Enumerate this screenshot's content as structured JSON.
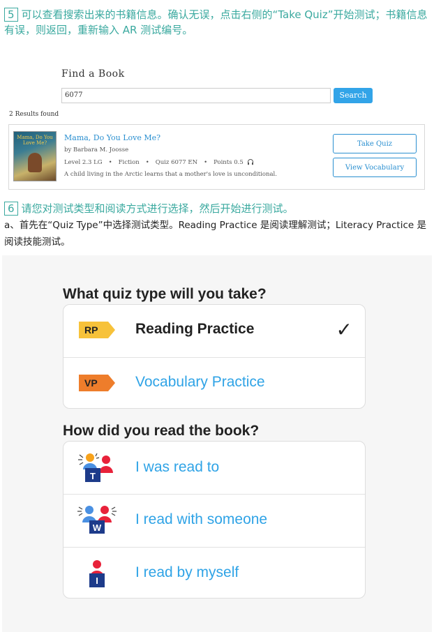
{
  "instructions": {
    "step5": {
      "number": "5",
      "text": "可以查看搜索出来的书籍信息。确认无误，点击右侧的“Take Quiz”开始测试；书籍信息有误，则返回，重新输入 AR 测试编号。"
    },
    "step6": {
      "number": "6",
      "text": "请您对测试类型和阅读方式进行选择，然后开始进行测试。"
    },
    "step6a": "a、首先在“Quiz Type”中选择测试类型。Reading Practice 是阅读理解测试；Literacy Practice 是阅读技能测试。"
  },
  "find_book": {
    "title": "Find a Book",
    "search_value": "6077",
    "search_button": "Search",
    "results_count": "2 Results found",
    "result": {
      "cover_title": "Mama, Do You Love Me?",
      "title": "Mama, Do You Love Me?",
      "author": "by Barbara M. Joosse",
      "level": "Level 2.3 LG",
      "genre": "Fiction",
      "quiz": "Quiz 6077 EN",
      "points": "Points 0.5",
      "description": "A child living in the Arctic learns that a mother's love is unconditional.",
      "take_quiz": "Take Quiz",
      "view_vocabulary": "View Vocabulary"
    }
  },
  "quiz_select": {
    "quiz_type_heading": "What quiz type will you take?",
    "quiz_types": [
      {
        "tag": "RP",
        "label": "Reading Practice",
        "selected": true,
        "tag_color": "#f7c23a"
      },
      {
        "tag": "VP",
        "label": "Vocabulary Practice",
        "selected": false,
        "tag_color": "#ee7d2b"
      }
    ],
    "check_mark": "✓",
    "read_heading": "How did you read the book?",
    "read_options": [
      {
        "label": "I was read to",
        "icon": "read-to-icon"
      },
      {
        "label": "I read with someone",
        "icon": "read-with-someone-icon"
      },
      {
        "label": "I read by myself",
        "icon": "read-by-myself-icon"
      }
    ],
    "accent_color": "#2fa3e6"
  }
}
